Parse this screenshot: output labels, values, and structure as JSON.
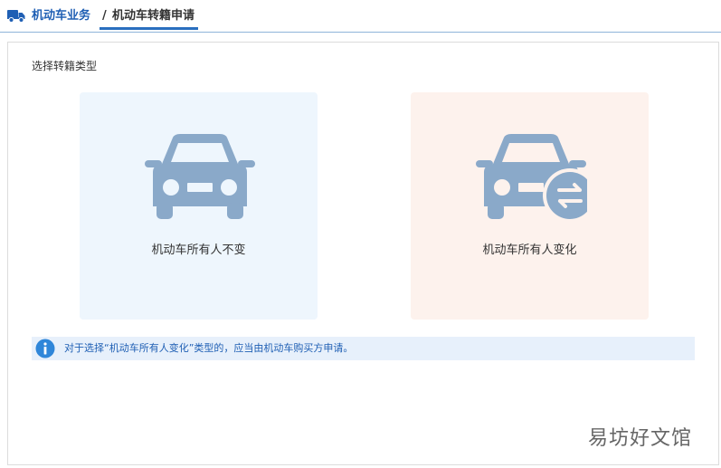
{
  "breadcrumb": {
    "root_label": "机动车业务",
    "separator": "/",
    "current_label": "机动车转籍申请",
    "icon": "truck-icon",
    "accent_color": "#1f5fb4"
  },
  "main": {
    "section_title": "选择转籍类型",
    "options": [
      {
        "label": "机动车所有人不变",
        "icon": "car-icon",
        "background": "#eef6fd"
      },
      {
        "label": "机动车所有人变化",
        "icon": "car-transfer-icon",
        "background": "#fdf2ed"
      }
    ],
    "notice": {
      "icon": "info-icon",
      "text": "对于选择“机动车所有人变化”类型的，应当由机动车购买方申请。"
    }
  },
  "watermark": {
    "text": "易坊好文馆"
  }
}
